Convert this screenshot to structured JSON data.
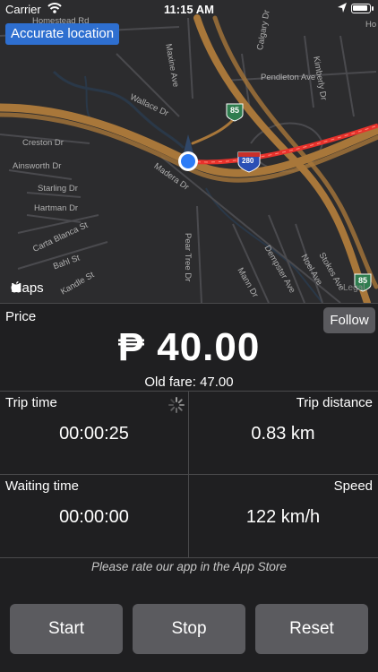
{
  "status_bar": {
    "carrier": "Carrier",
    "time": "11:15 AM"
  },
  "map": {
    "accurate_location_label": "Accurate location",
    "maps_label": "Maps",
    "legal_label": "Legal",
    "streets": {
      "homestead": "Homestead Rd",
      "maxine": "Maxine Ave",
      "calgary": "Calgary Dr",
      "kimberly": "Kimberly Dr",
      "pendleton": "Pendleton Ave",
      "wallace": "Wallace Dr",
      "creston": "Creston Dr",
      "ainsworth": "Ainsworth Dr",
      "starling": "Starling Dr",
      "hartman": "Hartman Dr",
      "madera": "Madera Dr",
      "carta_blanca": "Carta Blanca St",
      "bahl": "Bahl St",
      "kandle": "Kandle St",
      "pear_tree": "Pear Tree Dr",
      "mann": "Mann Dr",
      "dempster": "Dempster Ave",
      "noel": "Noel Ave",
      "stokes": "Stokes Ave",
      "ho": "Ho"
    },
    "shields": {
      "hwy85_a": "85",
      "hwy85_b": "85",
      "interstate": "280"
    }
  },
  "price": {
    "label": "Price",
    "follow_label": "Follow",
    "value": "₱ 40.00",
    "old_fare": "Old fare: 47.00"
  },
  "stats": {
    "trip_time_label": "Trip time",
    "trip_time_value": "00:00:25",
    "trip_distance_label": "Trip distance",
    "trip_distance_value": "0.83 km",
    "waiting_time_label": "Waiting time",
    "waiting_time_value": "00:00:00",
    "speed_label": "Speed",
    "speed_value": "122 km/h"
  },
  "rate_prompt": "Please rate our app in the App Store",
  "buttons": {
    "start": "Start",
    "stop": "Stop",
    "reset": "Reset"
  },
  "colors": {
    "route": "#e8322c",
    "highway": "#a8773a",
    "accent": "#2e6fd0"
  }
}
